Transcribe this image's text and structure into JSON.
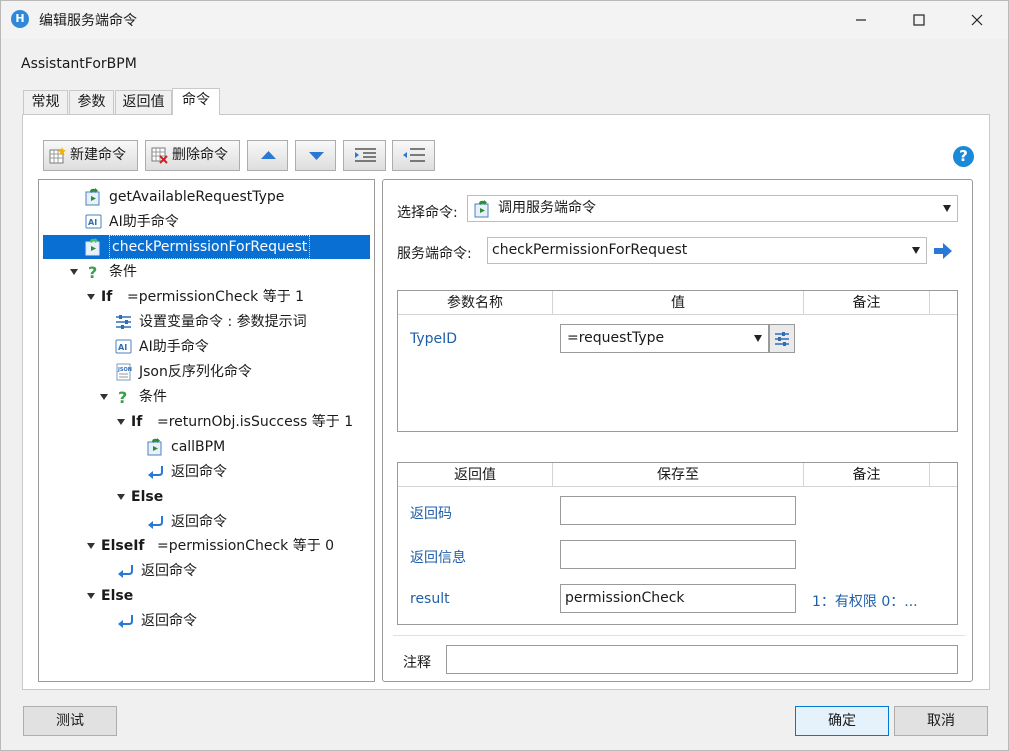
{
  "window": {
    "title": "编辑服务端命令",
    "app_icon_label": "H",
    "subtitle": "AssistantForBPM"
  },
  "tabs": [
    {
      "label": "常规"
    },
    {
      "label": "参数"
    },
    {
      "label": "返回值"
    },
    {
      "label": "命令"
    }
  ],
  "toolbar": {
    "new_label": "新建命令",
    "delete_label": "删除命令"
  },
  "help_label": "?",
  "tree": {
    "nodes": [
      {
        "text": "getAvailableRequestType",
        "icon": "server-command-icon"
      },
      {
        "text": "AI助手命令",
        "icon": "ai-assistant-icon"
      },
      {
        "text": "checkPermissionForRequest",
        "icon": "server-command-icon"
      },
      {
        "text": "条件",
        "icon": "condition-icon"
      },
      {
        "keyword": "If",
        "text": "=permissionCheck 等于 1"
      },
      {
        "text": "设置变量命令 : 参数提示词",
        "icon": "set-variable-icon"
      },
      {
        "text": "AI助手命令",
        "icon": "ai-assistant-icon"
      },
      {
        "text": "Json反序列化命令",
        "icon": "json-icon"
      },
      {
        "text": "条件",
        "icon": "condition-icon"
      },
      {
        "keyword": "If",
        "text": "=returnObj.isSuccess 等于 1"
      },
      {
        "text": "callBPM",
        "icon": "server-command-icon"
      },
      {
        "text": "返回命令",
        "icon": "return-icon"
      },
      {
        "keyword": "Else",
        "text": ""
      },
      {
        "text": "返回命令",
        "icon": "return-icon"
      },
      {
        "keyword": "ElseIf",
        "text": "=permissionCheck 等于 0"
      },
      {
        "text": "返回命令",
        "icon": "return-icon"
      },
      {
        "keyword": "Else",
        "text": ""
      },
      {
        "text": "返回命令",
        "icon": "return-icon"
      }
    ]
  },
  "form": {
    "select_command_label": "选择命令:",
    "select_command_value": "调用服务端命令",
    "server_command_label": "服务端命令:",
    "server_command_value": "checkPermissionForRequest",
    "params": {
      "headers": [
        "参数名称",
        "值",
        "备注"
      ],
      "rows": [
        {
          "name": "TypeID",
          "value": "=requestType",
          "note": ""
        }
      ]
    },
    "returns": {
      "headers": [
        "返回值",
        "保存至",
        "备注"
      ],
      "rows": [
        {
          "name": "返回码",
          "save_to": "",
          "note": ""
        },
        {
          "name": "返回信息",
          "save_to": "",
          "note": ""
        },
        {
          "name": "result",
          "save_to": "permissionCheck",
          "note": "1：有权限 0：..."
        }
      ]
    },
    "comment_label": "注释",
    "comment_value": ""
  },
  "buttons": {
    "test": "测试",
    "ok": "确定",
    "cancel": "取消"
  },
  "colors": {
    "selection": "#0a6fd3",
    "accent": "#1a8ad8",
    "link_text": "#1f5fa9"
  }
}
